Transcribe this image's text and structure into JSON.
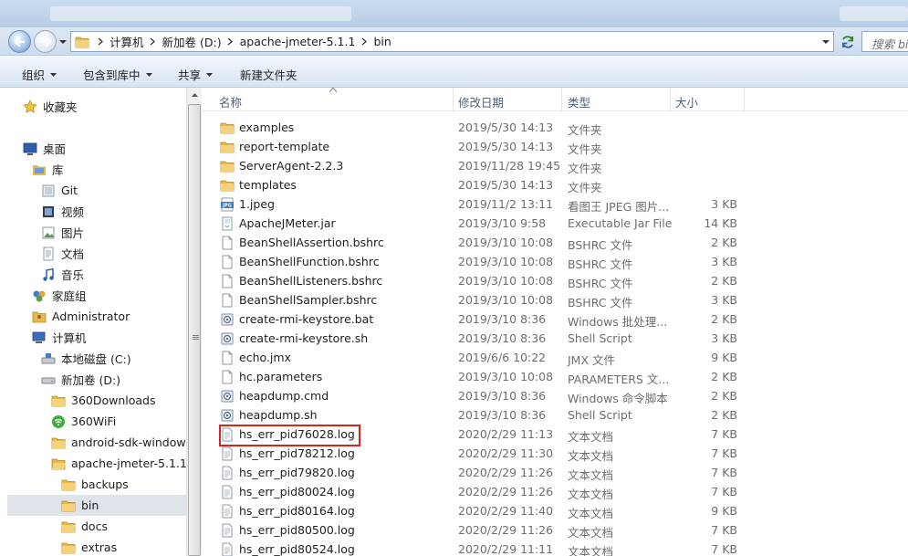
{
  "address": {
    "path": [
      "计算机",
      "新加卷 (D:)",
      "apache-jmeter-5.1.1",
      "bin"
    ],
    "search_placeholder": "搜索 bin"
  },
  "toolbar": {
    "organize": "组织",
    "include_in_library": "包含到库中",
    "share": "共享",
    "new_folder": "新建文件夹"
  },
  "nav": {
    "favorites": "收藏夹",
    "desktop": "桌面",
    "libraries": "库",
    "git": "Git",
    "videos": "视频",
    "pictures": "图片",
    "documents": "文档",
    "music": "音乐",
    "homegroup": "家庭组",
    "administrator": "Administrator",
    "computer": "计算机",
    "drive_c": "本地磁盘 (C:)",
    "drive_d": "新加卷 (D:)",
    "f_360downloads": "360Downloads",
    "f_360wifi": "360WiFi",
    "f_android": "android-sdk-windows",
    "f_jmeter": "apache-jmeter-5.1.1",
    "f_backups": "backups",
    "f_bin": "bin",
    "f_docs": "docs",
    "f_extras": "extras"
  },
  "columns": {
    "name": "名称",
    "date": "修改日期",
    "type": "类型",
    "size": "大小"
  },
  "files": [
    {
      "icon": "folder-icon",
      "name": "examples",
      "date": "2019/5/30 14:13",
      "type": "文件夹",
      "size": ""
    },
    {
      "icon": "folder-icon",
      "name": "report-template",
      "date": "2019/5/30 14:13",
      "type": "文件夹",
      "size": ""
    },
    {
      "icon": "folder-icon",
      "name": "ServerAgent-2.2.3",
      "date": "2019/11/28 19:45",
      "type": "文件夹",
      "size": ""
    },
    {
      "icon": "folder-icon",
      "name": "templates",
      "date": "2019/5/30 14:13",
      "type": "文件夹",
      "size": ""
    },
    {
      "icon": "jpeg-icon",
      "name": "1.jpeg",
      "date": "2019/11/2 13:11",
      "type": "看图王 JPEG 图片...",
      "size": "3 KB"
    },
    {
      "icon": "jar-icon",
      "name": "ApacheJMeter.jar",
      "date": "2019/3/10 9:58",
      "type": "Executable Jar File",
      "size": "14 KB"
    },
    {
      "icon": "file-icon",
      "name": "BeanShellAssertion.bshrc",
      "date": "2019/3/10 10:08",
      "type": "BSHRC 文件",
      "size": "2 KB"
    },
    {
      "icon": "file-icon",
      "name": "BeanShellFunction.bshrc",
      "date": "2019/3/10 10:08",
      "type": "BSHRC 文件",
      "size": "3 KB"
    },
    {
      "icon": "file-icon",
      "name": "BeanShellListeners.bshrc",
      "date": "2019/3/10 10:08",
      "type": "BSHRC 文件",
      "size": "2 KB"
    },
    {
      "icon": "file-icon",
      "name": "BeanShellSampler.bshrc",
      "date": "2019/3/10 10:08",
      "type": "BSHRC 文件",
      "size": "3 KB"
    },
    {
      "icon": "script-icon",
      "name": "create-rmi-keystore.bat",
      "date": "2019/3/10 8:36",
      "type": "Windows 批处理...",
      "size": "2 KB"
    },
    {
      "icon": "script-icon",
      "name": "create-rmi-keystore.sh",
      "date": "2019/3/10 8:36",
      "type": "Shell Script",
      "size": "3 KB"
    },
    {
      "icon": "file-icon",
      "name": "echo.jmx",
      "date": "2019/6/6 10:22",
      "type": "JMX 文件",
      "size": "9 KB"
    },
    {
      "icon": "file-icon",
      "name": "hc.parameters",
      "date": "2019/3/10 10:08",
      "type": "PARAMETERS 文...",
      "size": "2 KB"
    },
    {
      "icon": "script-icon",
      "name": "heapdump.cmd",
      "date": "2019/3/10 8:36",
      "type": "Windows 命令脚本",
      "size": "2 KB"
    },
    {
      "icon": "script-icon",
      "name": "heapdump.sh",
      "date": "2019/3/10 8:36",
      "type": "Shell Script",
      "size": "2 KB"
    },
    {
      "icon": "text-icon",
      "name": "hs_err_pid76028.log",
      "date": "2020/2/29 11:13",
      "type": "文本文档",
      "size": "7 KB"
    },
    {
      "icon": "text-icon",
      "name": "hs_err_pid78212.log",
      "date": "2020/2/29 11:30",
      "type": "文本文档",
      "size": "7 KB"
    },
    {
      "icon": "text-icon",
      "name": "hs_err_pid79820.log",
      "date": "2020/2/29 11:26",
      "type": "文本文档",
      "size": "7 KB"
    },
    {
      "icon": "text-icon",
      "name": "hs_err_pid80024.log",
      "date": "2020/2/29 11:26",
      "type": "文本文档",
      "size": "7 KB"
    },
    {
      "icon": "text-icon",
      "name": "hs_err_pid80164.log",
      "date": "2020/2/29 11:40",
      "type": "文本文档",
      "size": "9 KB"
    },
    {
      "icon": "text-icon",
      "name": "hs_err_pid80500.log",
      "date": "2020/2/29 11:26",
      "type": "文本文档",
      "size": "7 KB"
    },
    {
      "icon": "text-icon",
      "name": "hs_err_pid80524.log",
      "date": "2020/2/29 11:11",
      "type": "文本文档",
      "size": "7 KB"
    }
  ],
  "colors": {
    "highlight": "#d9231e",
    "folder": "#e8b84a",
    "selected_nav": "#dfe4ea"
  }
}
